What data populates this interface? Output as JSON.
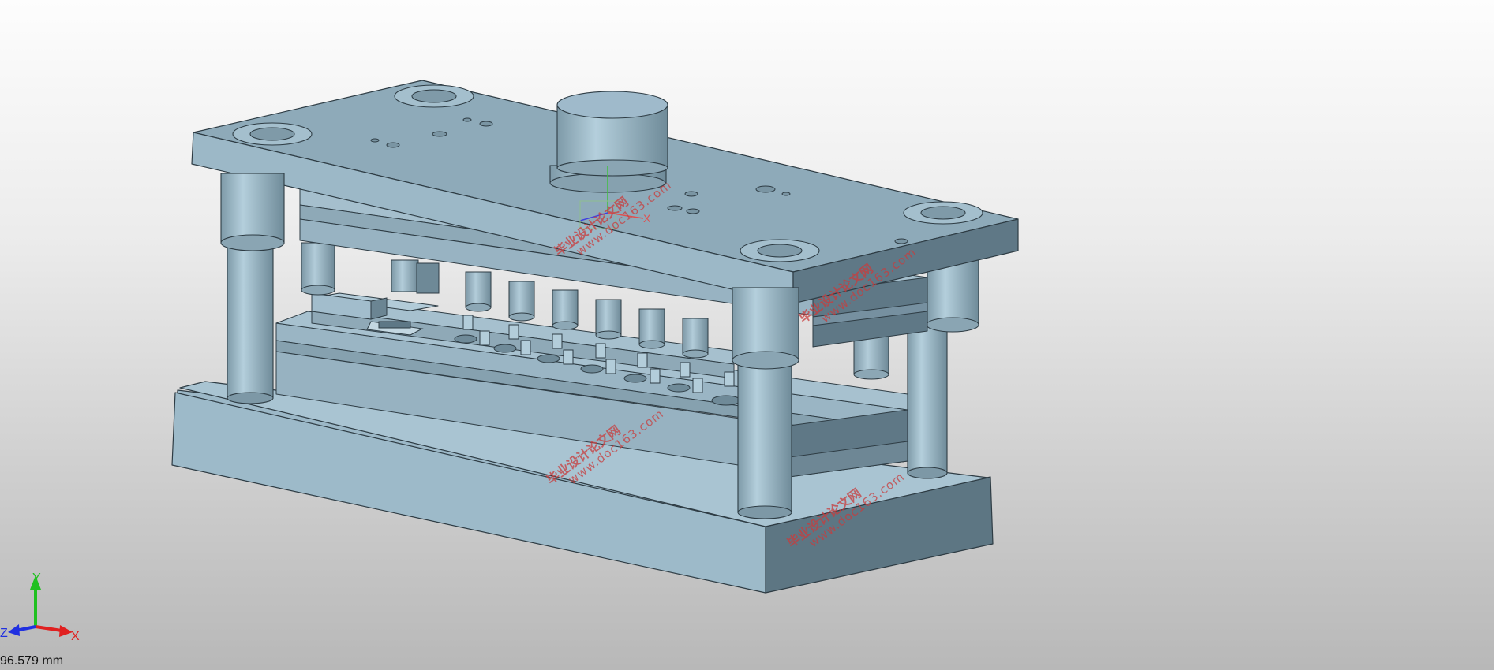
{
  "viewport": {
    "scale_readout": "96.579 mm",
    "triad_axes": [
      "X",
      "Y",
      "Z"
    ],
    "model_color": "#9fbccb",
    "colors": {
      "x_axis": "#e02020",
      "y_axis": "#20c020",
      "z_axis": "#2030e0",
      "watermark": "#c83c3c"
    }
  },
  "watermarks": [
    {
      "cn": "毕业设计论文网",
      "url": "www.doc163.com"
    },
    {
      "cn": "毕业设计论文网",
      "url": "www.doc163.com"
    },
    {
      "cn": "毕业设计论文网",
      "url": "www.doc163.com"
    },
    {
      "cn": "毕业设计论文网",
      "url": "www.doc163.com"
    }
  ]
}
